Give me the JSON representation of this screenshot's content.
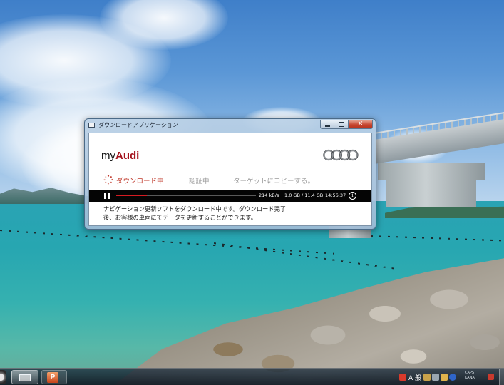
{
  "window": {
    "title": "ダウンロードアプリケーション",
    "close_label": "✕"
  },
  "app": {
    "brand_prefix": "my",
    "brand_name": "Audi",
    "logo": "audi-four-rings-logo"
  },
  "steps": [
    {
      "label": "ダウンロード中",
      "state": "active"
    },
    {
      "label": "認証中",
      "state": "pending"
    },
    {
      "label": "ターゲットにコピーする。",
      "state": "pending"
    }
  ],
  "download": {
    "progress_fraction": 0.22,
    "speed": "214 kB/s",
    "size": "1.0 GB / 11.4 GB",
    "time_remaining": "14:56:37",
    "info_label": "i"
  },
  "message": {
    "line1": "ナビゲーション更新ソフトをダウンロード中です。ダウンロード完了",
    "line2": "後、お客様の車両にてデータを更新することができます。"
  },
  "taskbar": {
    "ppt_label": "P",
    "ime_label": "A 般",
    "tray_line1": "CAPS",
    "tray_line2": "KANA"
  },
  "colors": {
    "accent_red": "#c0392b",
    "progress_fill": "#d61b22",
    "progress_background": "#050505",
    "inactive_step": "#9a9a9a"
  },
  "icons": [
    "loading-spinner-icon",
    "pause-icon",
    "info-icon",
    "minimize-icon",
    "maximize-icon",
    "close-icon",
    "start-orb-icon",
    "powerpoint-icon"
  ]
}
